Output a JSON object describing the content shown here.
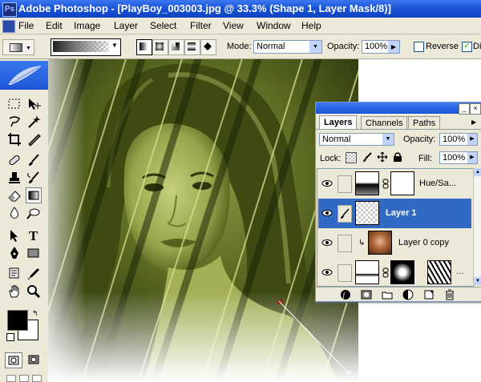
{
  "window": {
    "title": "Adobe Photoshop - [PlayBoy_003003.jpg @ 33.3% (Shape 1, Layer Mask/8)]",
    "icon_label": "Ps"
  },
  "menu": {
    "items": [
      "File",
      "Edit",
      "Image",
      "Layer",
      "Select",
      "Filter",
      "View",
      "Window",
      "Help"
    ]
  },
  "options": {
    "mode_label": "Mode:",
    "mode_value": "Normal",
    "opacity_label": "Opacity:",
    "opacity_value": "100%",
    "reverse_label": "Reverse",
    "dither_label": "Di",
    "dither_checked": true,
    "reverse_checked": false
  },
  "layers_panel": {
    "tabs": [
      "Layers",
      "Channels",
      "Paths"
    ],
    "active_tab": "Layers",
    "blend_mode": "Normal",
    "opacity_label": "Opacity:",
    "opacity_value": "100%",
    "lock_label": "Lock:",
    "fill_label": "Fill:",
    "fill_value": "100%",
    "layers": [
      {
        "name": "Hue/Sa...",
        "type": "adjustment",
        "selected": false
      },
      {
        "name": "Layer 1",
        "type": "transparent",
        "selected": true
      },
      {
        "name": "Layer 0 copy",
        "type": "photo",
        "selected": false
      },
      {
        "name": "",
        "type": "shape-mask",
        "selected": false
      }
    ]
  },
  "colors": {
    "titlebar": "#1b55d6",
    "selection": "#316ac5",
    "photo_tint": "#8a9a3a",
    "chrome": "#ece9d8"
  }
}
